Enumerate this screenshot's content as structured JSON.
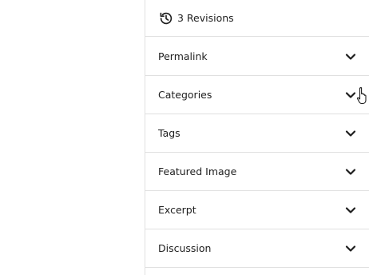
{
  "revisions": {
    "label": "3 Revisions",
    "icon": "history-icon"
  },
  "panels": [
    {
      "title": "Permalink"
    },
    {
      "title": "Categories"
    },
    {
      "title": "Tags"
    },
    {
      "title": "Featured Image"
    },
    {
      "title": "Excerpt"
    },
    {
      "title": "Discussion"
    }
  ],
  "colors": {
    "border": "#e0e0e0",
    "text": "#1e1e1e",
    "background": "#ffffff"
  }
}
